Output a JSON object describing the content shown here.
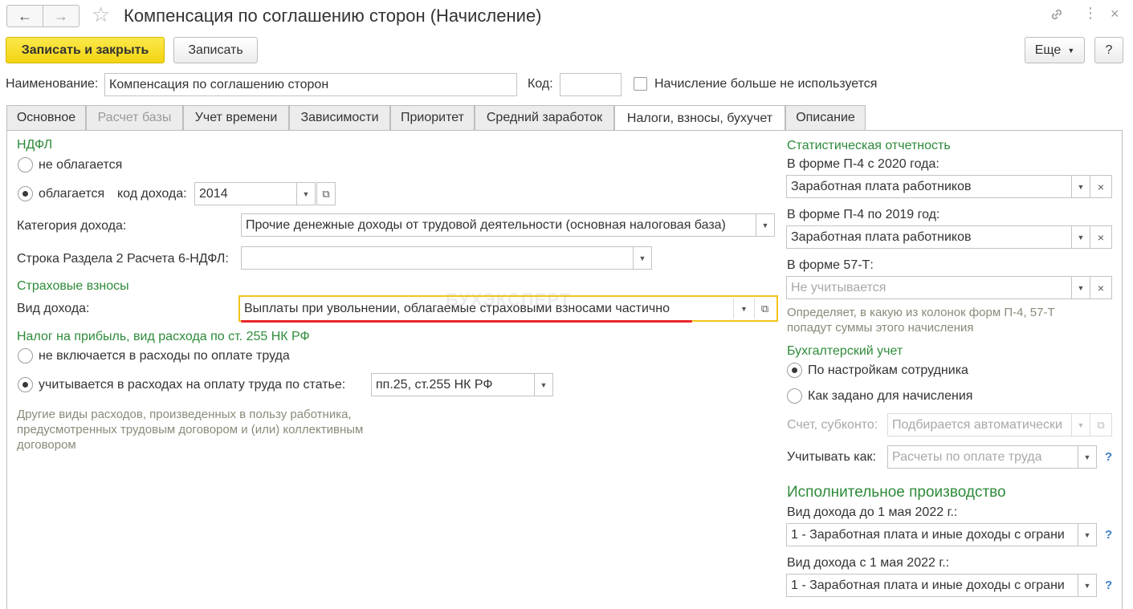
{
  "window": {
    "title": "Компенсация по соглашению сторон (Начисление)",
    "nav_back_icon": "arrow-left-icon",
    "nav_forward_icon": "arrow-right-icon",
    "favorite_icon": "star-icon"
  },
  "toolbar": {
    "save_close_label": "Записать и закрыть",
    "save_label": "Записать",
    "more_label": "Еще",
    "help_label": "?"
  },
  "header": {
    "name_label": "Наименование:",
    "name_value": "Компенсация по соглашению сторон",
    "code_label": "Код:",
    "code_value": "",
    "unused_label": "Начисление больше не используется"
  },
  "tabs": [
    {
      "label": "Основное",
      "state": "normal"
    },
    {
      "label": "Расчет базы",
      "state": "disabled"
    },
    {
      "label": "Учет времени",
      "state": "normal"
    },
    {
      "label": "Зависимости",
      "state": "normal"
    },
    {
      "label": "Приоритет",
      "state": "normal"
    },
    {
      "label": "Средний заработок",
      "state": "normal"
    },
    {
      "label": "Налоги, взносы, бухучет",
      "state": "active"
    },
    {
      "label": "Описание",
      "state": "normal"
    }
  ],
  "ndfl": {
    "title": "НДФЛ",
    "not_taxed_label": "не облагается",
    "taxed_label": "облагается",
    "income_code_label": "код дохода:",
    "income_code_value": "2014",
    "income_category_label": "Категория дохода:",
    "income_category_value": "Прочие денежные доходы от трудовой деятельности (основная налоговая база)",
    "section2_label": "Строка Раздела 2 Расчета 6-НДФЛ:",
    "section2_value": ""
  },
  "insurance": {
    "title": "Страховые взносы",
    "income_type_label": "Вид дохода:",
    "income_type_value": "Выплаты при увольнении, облагаемые страховыми взносами частично"
  },
  "profit_tax": {
    "title": "Налог на прибыль, вид расхода по ст. 255 НК РФ",
    "not_included_label": "не включается в расходы по оплате труда",
    "included_label": "учитывается в расходах на оплату труда по статье:",
    "article_value": "пп.25, ст.255 НК РФ",
    "note": [
      "Другие виды расходов, произведенных в пользу работника,",
      "предусмотренных трудовым договором и (или) коллективным",
      "договором"
    ]
  },
  "statistics": {
    "title": "Статистическая отчетность",
    "p4_2020_label": "В форме П-4 с 2020 года:",
    "p4_2020_value": "Заработная плата работников",
    "p4_2019_label": "В форме П-4 по 2019 год:",
    "p4_2019_value": "Заработная плата работников",
    "f57_label": "В форме 57-Т:",
    "f57_placeholder": "Не учитывается",
    "note": [
      "Определяет, в какую из колонок форм П-4, 57-Т",
      "попадут суммы этого начисления"
    ]
  },
  "accounting": {
    "title": "Бухгалтерский учет",
    "by_employee_label": "По настройкам сотрудника",
    "as_set_label": "Как задано для начисления",
    "account_label": "Счет, субконто:",
    "account_placeholder": "Подбирается автоматически",
    "consider_as_label": "Учитывать как:",
    "consider_as_placeholder": "Расчеты по оплате труда"
  },
  "enforcement": {
    "title": "Исполнительное производство",
    "before_label": "Вид дохода до 1 мая 2022 г.:",
    "before_value": "1 - Заработная плата и иные доходы с ограни",
    "after_label": "Вид дохода с 1 мая 2022 г.:",
    "after_value": "1 - Заработная плата и иные доходы с ограни"
  },
  "watermark": "БУХЭКСПЕРТ",
  "colors": {
    "accent_yellow": "#f3d412",
    "section_green": "#2e8b3a",
    "highlight_red": "#e8262a",
    "focus_border": "#f2c419"
  }
}
